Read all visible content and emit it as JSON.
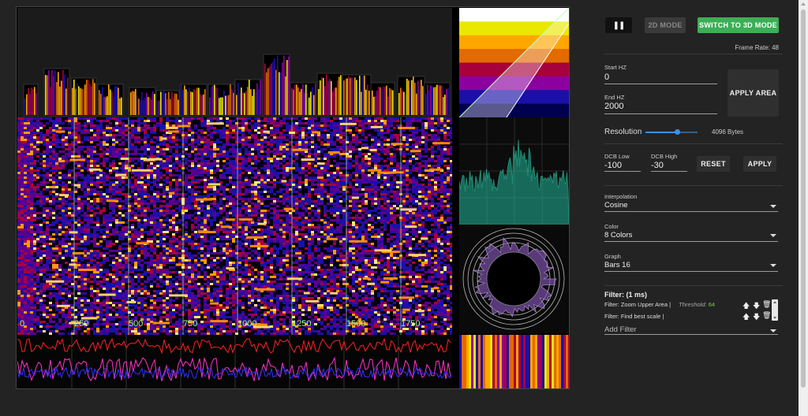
{
  "toolbar": {
    "pause_icon": "pause-icon",
    "mode2d_label": "2D MODE",
    "mode3d_label": "SWITCH TO 3D MODE",
    "frame_rate": "Frame Rate: 48"
  },
  "range": {
    "start_label": "Start HZ",
    "start_value": "0",
    "end_label": "End HZ",
    "end_value": "2000",
    "apply_label": "APPLY AREA"
  },
  "resolution": {
    "label": "Resolution",
    "value_text": "4096 Bytes",
    "level": 0.62
  },
  "dcb": {
    "low_label": "DCB Low",
    "low_value": "-100",
    "high_label": "DCB High",
    "high_value": "-30",
    "reset_label": "RESET",
    "apply_label": "APPLY"
  },
  "interpolation": {
    "label": "Interpolation",
    "value": "Cosine"
  },
  "color": {
    "label": "Color",
    "value": "8 Colors"
  },
  "graph": {
    "label": "Graph",
    "value": "Bars 16"
  },
  "filters": {
    "title": "Filter: (1 ms)",
    "items": [
      {
        "text": "Filter: Zoom Upper Area |",
        "extra_label": "Threshold:",
        "extra_value": "64"
      },
      {
        "text": "Filter: Find best scale |"
      }
    ],
    "add_label": "Add Filter"
  },
  "spectrogram": {
    "freq_ticks": [
      "0",
      "250",
      "500",
      "750",
      "1000",
      "1250",
      "1500",
      "1750"
    ]
  },
  "colors": {
    "accent_green": "#3cae56",
    "threshold_green": "#6fd04e",
    "slider_blue": "#3a8fe8",
    "palette": [
      "#ffffff",
      "#ebe800",
      "#ffa600",
      "#e26a00",
      "#a8003c",
      "#8c00a0",
      "#1a10a8",
      "#000050"
    ]
  }
}
